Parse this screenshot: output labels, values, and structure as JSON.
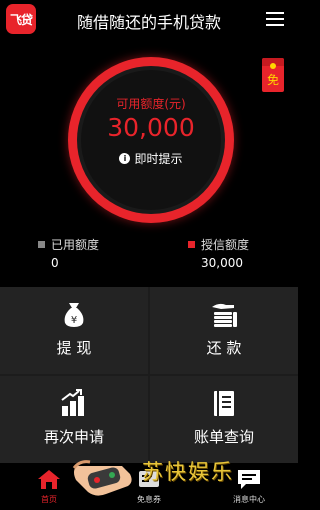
{
  "header": {
    "logo_text": "飞贷",
    "title": "随借随还的手机贷款"
  },
  "free_badge": {
    "text": "免"
  },
  "credit_dial": {
    "label": "可用额度(元)",
    "value": "30,000",
    "hint": "即时提示"
  },
  "stats": [
    {
      "label": "已用额度",
      "value": "0",
      "color": "#888888"
    },
    {
      "label": "授信额度",
      "value": "30,000",
      "color": "#e8242b"
    }
  ],
  "actions": [
    {
      "label": "提 现",
      "icon": "money-bag-icon"
    },
    {
      "label": "还 款",
      "icon": "coins-hand-icon"
    },
    {
      "label": "再次申请",
      "icon": "bar-chart-up-icon"
    },
    {
      "label": "账单查询",
      "icon": "notebook-icon"
    }
  ],
  "tabbar": [
    {
      "label": "首页",
      "icon": "home-icon",
      "active": true
    },
    {
      "label": "免息券",
      "icon": "coupon-icon",
      "active": false
    },
    {
      "label": "",
      "icon": "",
      "active": false
    },
    {
      "label": "消息中心",
      "icon": "message-icon",
      "active": false
    }
  ],
  "watermark": {
    "text": "苏快娱乐"
  },
  "colors": {
    "accent": "#e8242b",
    "background": "#000000",
    "panel": "#232323"
  }
}
